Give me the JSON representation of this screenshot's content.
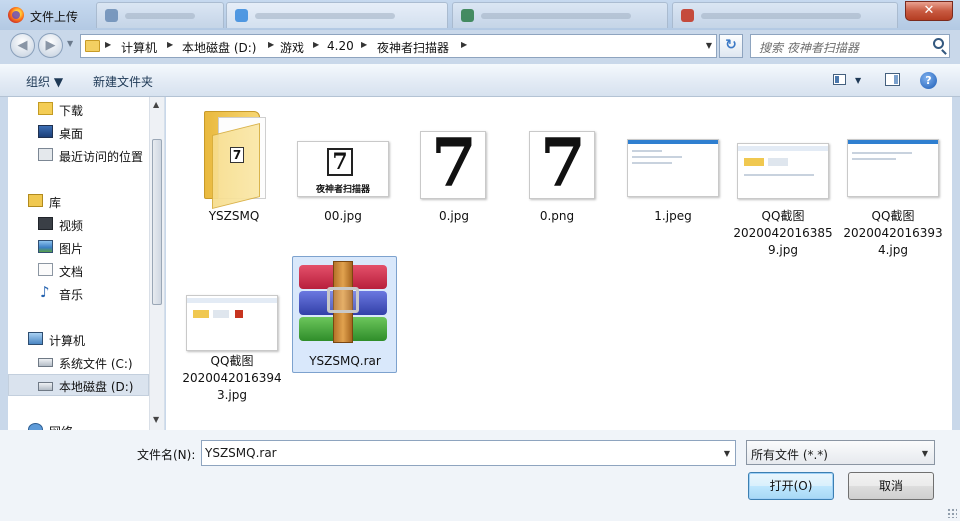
{
  "window": {
    "title": "文件上传",
    "close_label": "✕"
  },
  "nav": {
    "back_label": "◀",
    "forward_label": "▶",
    "drop_label": "▼"
  },
  "address": {
    "crumbs": [
      "计算机",
      "本地磁盘 (D:)",
      "游戏",
      "4.20",
      "夜神者扫描器"
    ],
    "separator": "▶",
    "drop": "▼",
    "refresh": "↻"
  },
  "search": {
    "placeholder": "搜索 夜神者扫描器"
  },
  "toolbar": {
    "organize_label": "组织 ▼",
    "new_folder_label": "新建文件夹",
    "view_drop": "▼",
    "help_label": "?"
  },
  "sidebar": {
    "items": [
      {
        "label": "下载",
        "icon": "download-folder-icon"
      },
      {
        "label": "桌面",
        "icon": "desktop-icon"
      },
      {
        "label": "最近访问的位置",
        "icon": "recent-places-icon"
      },
      {
        "label": "库",
        "icon": "library-icon"
      },
      {
        "label": "视频",
        "icon": "video-icon"
      },
      {
        "label": "图片",
        "icon": "pictures-icon"
      },
      {
        "label": "文档",
        "icon": "documents-icon"
      },
      {
        "label": "音乐",
        "icon": "music-icon"
      },
      {
        "label": "计算机",
        "icon": "computer-icon"
      },
      {
        "label": "系统文件 (C:)",
        "icon": "drive-c-icon"
      },
      {
        "label": "本地磁盘 (D:)",
        "icon": "drive-d-icon"
      },
      {
        "label": "网络",
        "icon": "network-icon"
      }
    ],
    "selected": "本地磁盘 (D:)",
    "scroll_up": "▲",
    "scroll_down": "▼"
  },
  "files": [
    {
      "name": "YSZSMQ",
      "kind": "folder",
      "thumb_text": "7"
    },
    {
      "name": "00.jpg",
      "kind": "image",
      "thumb_text": "7",
      "thumb_caption": "夜神者扫描器"
    },
    {
      "name": "0.jpg",
      "kind": "image",
      "thumb_text": "7"
    },
    {
      "name": "0.png",
      "kind": "image",
      "thumb_text": "7"
    },
    {
      "name": "1.jpeg",
      "kind": "screenshot"
    },
    {
      "name_lines": [
        "QQ截图",
        "2020042016385",
        "9.jpg"
      ],
      "kind": "screenshot"
    },
    {
      "name_lines": [
        "QQ截图",
        "2020042016393",
        "4.jpg"
      ],
      "kind": "screenshot"
    },
    {
      "name_lines": [
        "QQ截图",
        "2020042016394",
        "3.jpg"
      ],
      "kind": "screenshot"
    },
    {
      "name": "YSZSMQ.rar",
      "kind": "archive",
      "selected": true
    }
  ],
  "bottom": {
    "filename_label": "文件名(N):",
    "filename_value": "YSZSMQ.rar",
    "filename_drop": "▼",
    "filetype_value": "所有文件 (*.*)",
    "filetype_drop": "▼",
    "open_label": "打开(O)",
    "cancel_label": "取消"
  },
  "colors": {
    "accent": "#3c7fb1",
    "selection": "#d9e8fb",
    "titlebar": "#c6d9ef"
  }
}
